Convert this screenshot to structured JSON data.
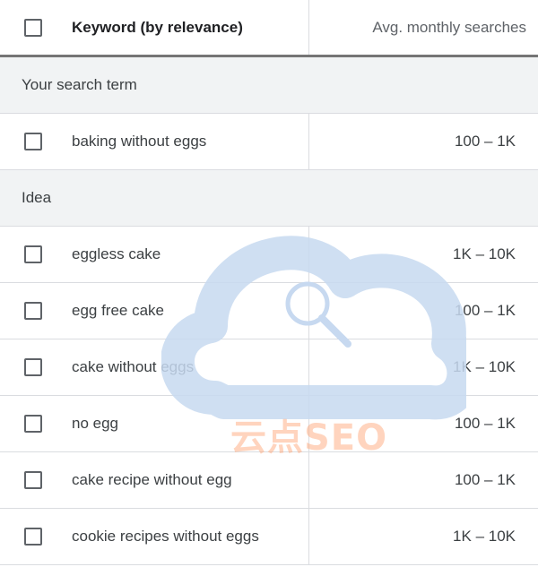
{
  "header": {
    "keyword_label": "Keyword (by relevance)",
    "searches_label": "Avg. monthly searches"
  },
  "groups": {
    "search_term": "Your search term",
    "idea": "Idea"
  },
  "search_term_rows": [
    {
      "keyword": "baking without eggs",
      "searches": "100 – 1K"
    }
  ],
  "idea_rows": [
    {
      "keyword": "eggless cake",
      "searches": "1K – 10K"
    },
    {
      "keyword": "egg free cake",
      "searches": "100 – 1K"
    },
    {
      "keyword": "cake without eggs",
      "searches": "1K – 10K"
    },
    {
      "keyword": "no egg",
      "searches": "100 – 1K"
    },
    {
      "keyword": "cake recipe without egg",
      "searches": "100 – 1K"
    },
    {
      "keyword": "cookie recipes without eggs",
      "searches": "1K – 10K"
    }
  ],
  "watermark": {
    "text": "云点SEO",
    "icon": "cloud-search-icon",
    "cloud_color": "#c7d9f0",
    "text_color": "#ffa06e"
  }
}
